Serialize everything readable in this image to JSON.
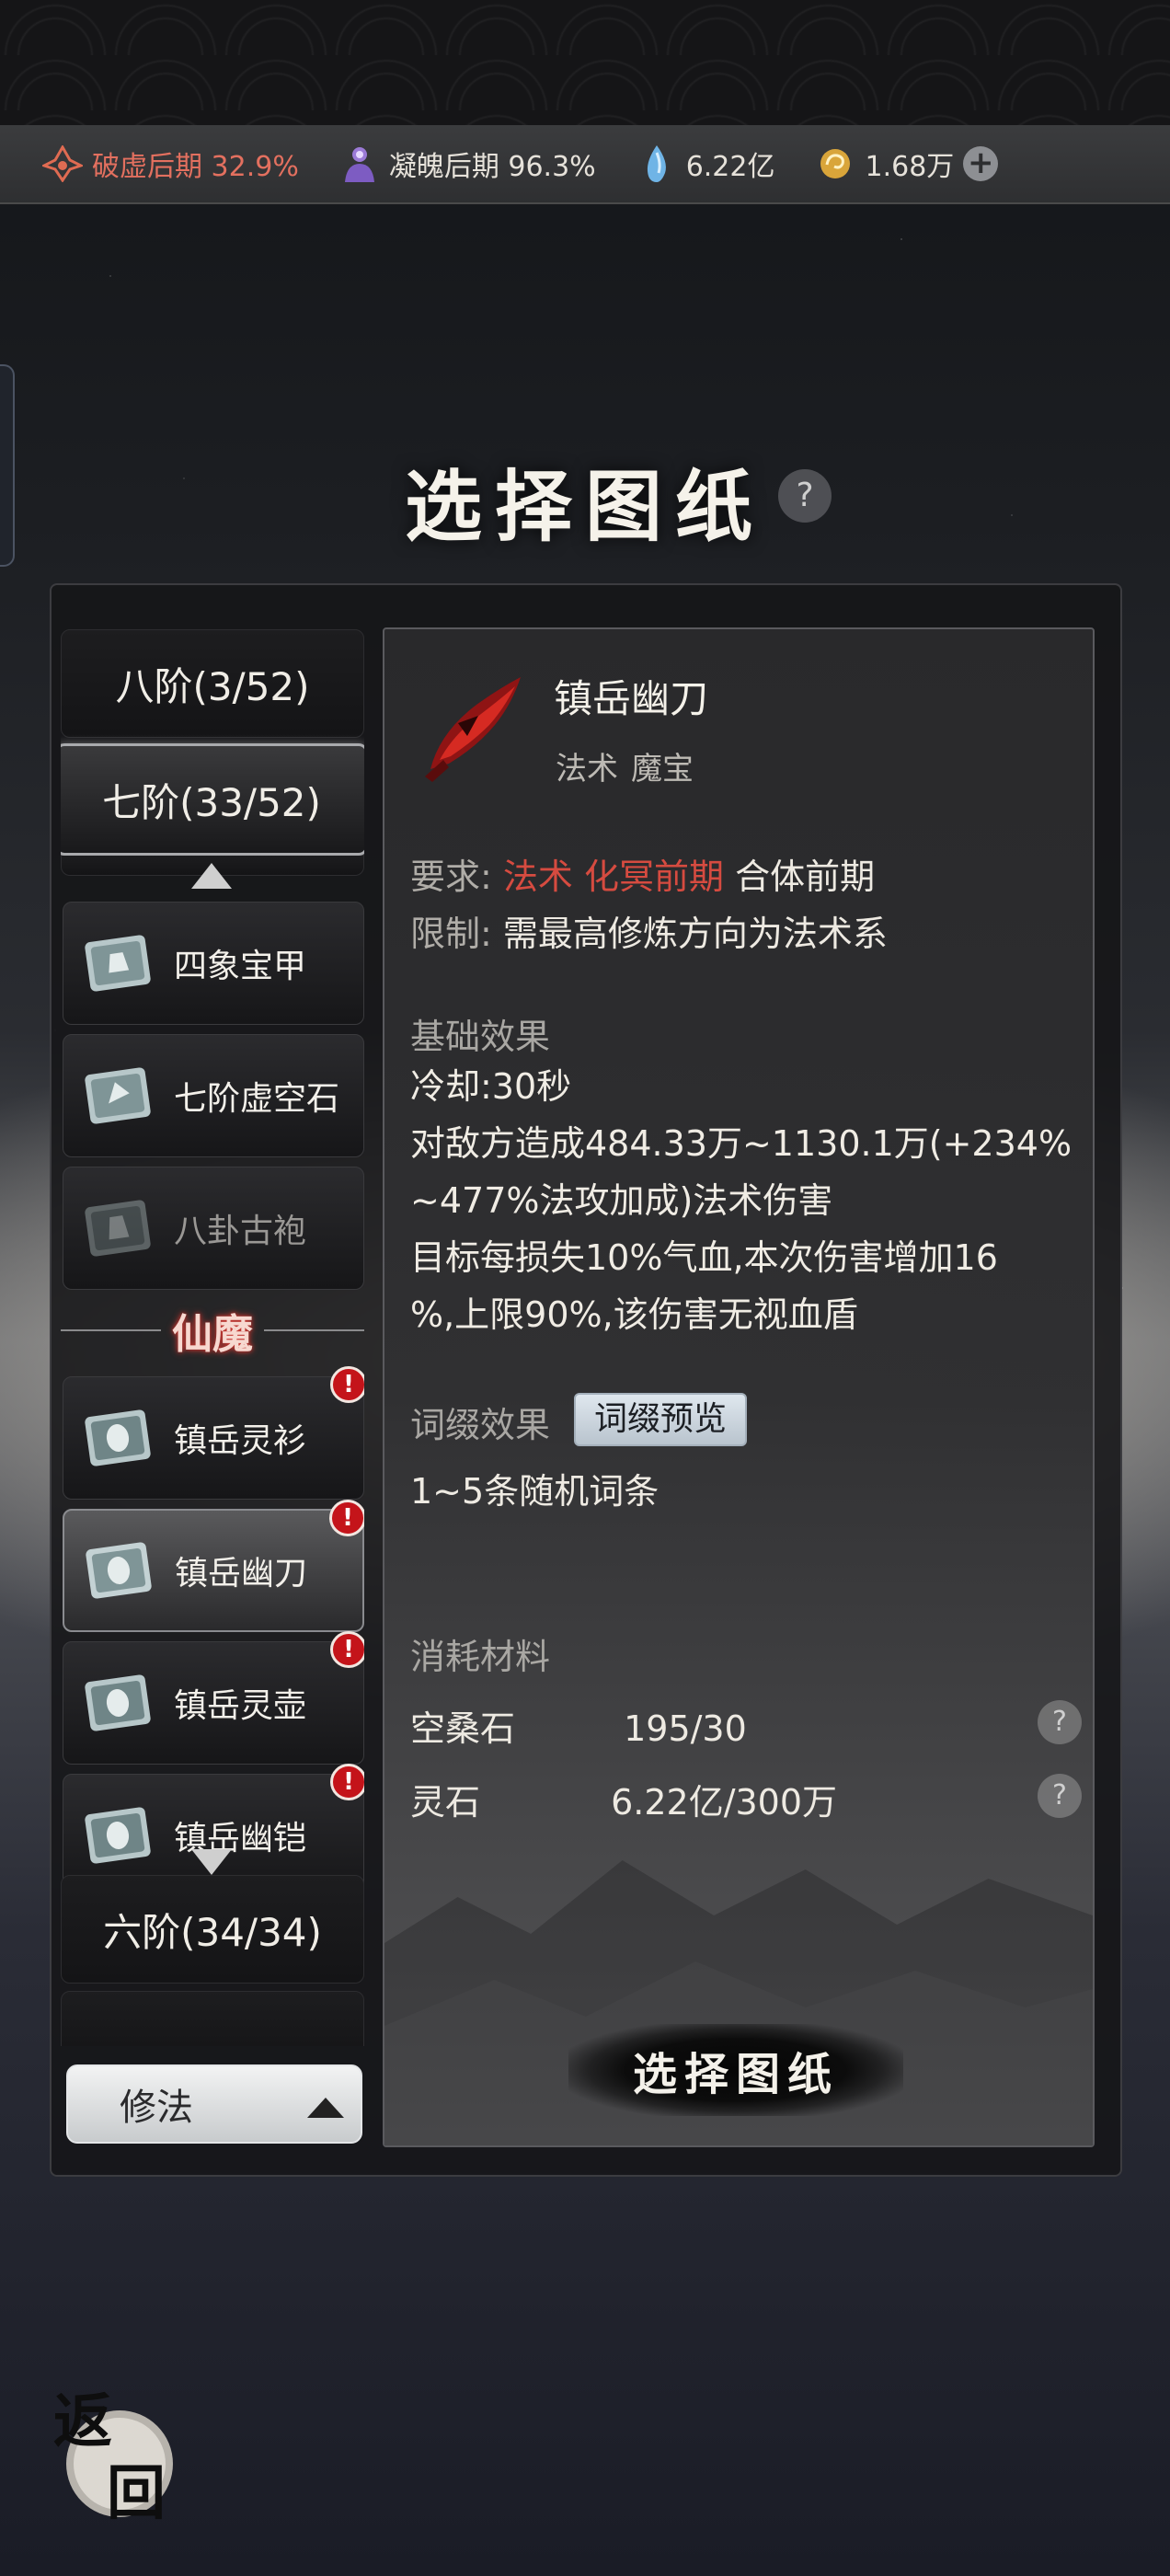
{
  "status_bar": {
    "realm1": "破虚后期 32.9%",
    "realm2": "凝魄后期 96.3%",
    "spirit_stones": "6.22亿",
    "currency": "1.68万",
    "add_label": "+"
  },
  "title": "选择图纸",
  "help_label": "?",
  "tiers": {
    "tier8": "八阶(3/52)",
    "tier7": "七阶(33/52)",
    "tier6": "六阶(34/34)"
  },
  "blueprints_top": [
    {
      "label": "四象宝甲"
    },
    {
      "label": "七阶虚空石"
    },
    {
      "label": "八卦古袍"
    }
  ],
  "section_divider": "仙魔",
  "blueprints_xianmo": [
    {
      "label": "镇岳灵衫",
      "alert": "!"
    },
    {
      "label": "镇岳幽刀",
      "alert": "!"
    },
    {
      "label": "镇岳灵壶",
      "alert": "!"
    },
    {
      "label": "镇岳幽铠",
      "alert": "!"
    }
  ],
  "school_selector": {
    "label": "修法"
  },
  "detail": {
    "name": "镇岳幽刀",
    "tag1": "法术",
    "tag2": "魔宝",
    "req_label": "要求:",
    "req_school": "法术",
    "req_realm": "化冥前期",
    "req_realm2": "合体前期",
    "limit_label": "限制:",
    "limit_text": "需最高修炼方向为法术系",
    "base_title": "基础效果",
    "cooldown": "冷却:30秒",
    "effect_line1": "对敌方造成484.33万~1130.1万(+234%",
    "effect_line2": "~477%法攻加成)法术伤害",
    "effect_line3": "目标每损失10%气血,本次伤害增加16",
    "effect_line4": "%,上限90%,该伤害无视血盾",
    "affix_title": "词缀效果",
    "affix_preview": "词缀预览",
    "affix_text": "1~5条随机词条",
    "cost_title": "消耗材料",
    "materials": [
      {
        "name": "空桑石",
        "amount": "195/30"
      },
      {
        "name": "灵石",
        "amount": "6.22亿/300万"
      }
    ]
  },
  "select_button": "选择图纸",
  "back_button": {
    "char1": "返",
    "char2": "回"
  },
  "colors": {
    "accent_red": "#d64b40",
    "alert_red": "#c4141a"
  }
}
